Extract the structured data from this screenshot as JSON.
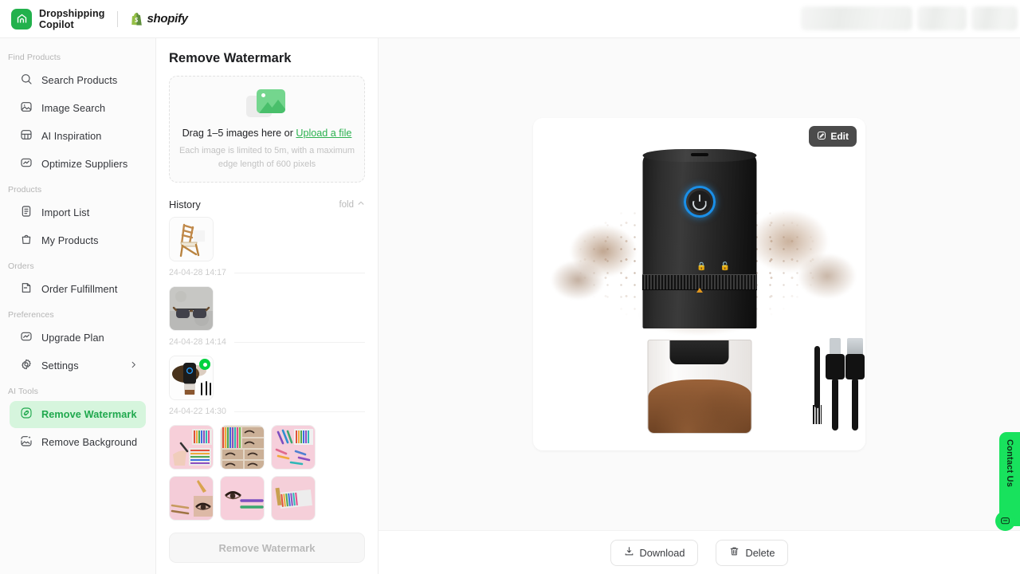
{
  "brand": {
    "name": "Dropshipping\nCopilot",
    "partner": "shopify",
    "logo_icon": "app-logo-icon",
    "shopify_icon": "shopify-bag-icon"
  },
  "sidebar": {
    "groups": [
      {
        "title": "Find Products",
        "items": [
          {
            "label": "Search Products",
            "icon": "search-icon",
            "active": false
          },
          {
            "label": "Image Search",
            "icon": "image-search-icon",
            "active": false
          },
          {
            "label": "AI Inspiration",
            "icon": "grid-sparkle-icon",
            "active": false
          },
          {
            "label": "Optimize Suppliers",
            "icon": "chart-box-icon",
            "active": false
          }
        ]
      },
      {
        "title": "Products",
        "items": [
          {
            "label": "Import List",
            "icon": "clipboard-icon",
            "active": false
          },
          {
            "label": "My Products",
            "icon": "bag-icon",
            "active": false
          }
        ]
      },
      {
        "title": "Orders",
        "items": [
          {
            "label": "Order Fulfillment",
            "icon": "order-box-icon",
            "active": false
          }
        ]
      },
      {
        "title": "Preferences",
        "items": [
          {
            "label": "Upgrade Plan",
            "icon": "chart-box-icon",
            "active": false
          },
          {
            "label": "Settings",
            "icon": "gear-icon",
            "active": false,
            "chevron": "chevron-right-icon"
          }
        ]
      },
      {
        "title": "AI Tools",
        "items": [
          {
            "label": "Remove Watermark",
            "icon": "watermark-icon",
            "active": true
          },
          {
            "label": "Remove Background",
            "icon": "remove-background-icon",
            "active": false
          }
        ]
      }
    ]
  },
  "panel": {
    "title": "Remove Watermark",
    "dropzone": {
      "icon": "image-placeholder-icon",
      "prompt_prefix": "Drag 1–5 images here or ",
      "upload_link": "Upload a file",
      "hint": "Each image is limited to 5m, with a maximum edge length of 600 pixels"
    },
    "history": {
      "title": "History",
      "fold_label": "fold",
      "fold_icon": "chevron-up-icon",
      "entries": [
        {
          "timestamp": "24-04-28 14:17",
          "thumb": "wooden-folding-chair",
          "selected": false
        },
        {
          "timestamp": "24-04-28 14:14",
          "thumb": "sunglasses-on-stone",
          "selected": false
        },
        {
          "timestamp": "24-04-22 14:30",
          "thumb": "coffee-grinder",
          "selected": true
        }
      ],
      "grid_thumbs": [
        "eyeliner-hand-swatch",
        "eye-makeup-chart",
        "eyeliner-pencils-scatter",
        "eyeliner-eye-closeup",
        "eye-with-pencils",
        "pencil-set-box"
      ]
    },
    "submit_label": "Remove Watermark",
    "submit_disabled": true
  },
  "stage": {
    "edit_button": {
      "label": "Edit",
      "icon": "edit-pencil-icon"
    },
    "preview_alt": "black portable electric coffee grinder with coffee grounds splash, cleaning brush and USB cables",
    "actions": [
      {
        "label": "Download",
        "icon": "download-icon"
      },
      {
        "label": "Delete",
        "icon": "trash-icon"
      }
    ]
  },
  "contact_widget": {
    "label": "Contact Us",
    "icon": "chat-bubble-icon"
  },
  "colors": {
    "brand_green": "#22b14c",
    "accent_green": "#2bb14f",
    "active_bg": "#d6f5dd",
    "contact_green": "#18e25d",
    "selected_dot": "#00d13f",
    "power_ring_blue": "#1a8fe8"
  }
}
